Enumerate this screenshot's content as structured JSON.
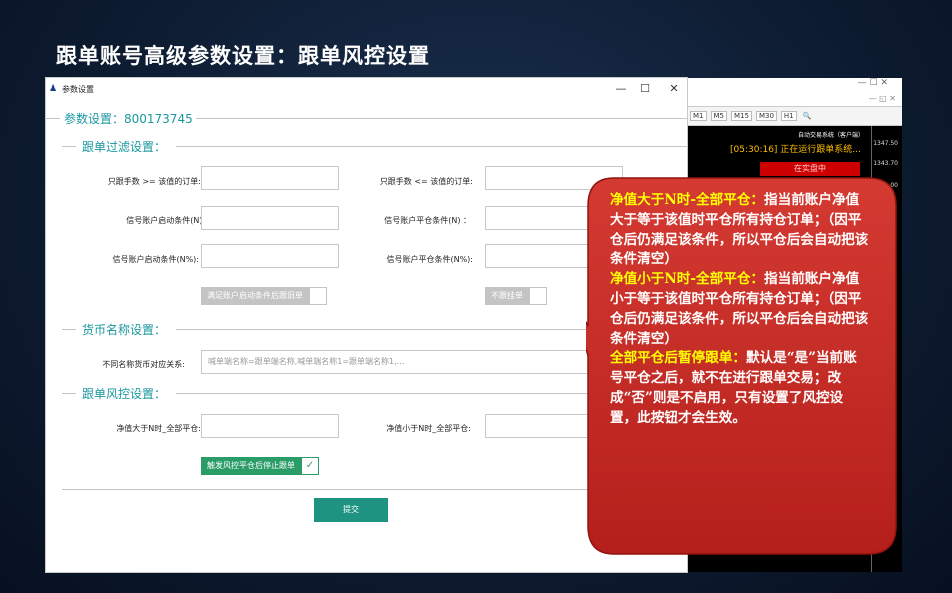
{
  "slide_title": "跟单账号高级参数设置：跟单风控设置",
  "dialog": {
    "title": "参数设置",
    "window_controls": [
      "—",
      "☐",
      "✕"
    ],
    "heading": "参数设置：800173745",
    "filter_section": {
      "title": "跟单过滤设置：",
      "fields": [
        {
          "label": "只跟手数 >= 该值的订单:"
        },
        {
          "label": "只跟手数 <= 该值的订单:"
        },
        {
          "label": "信号账户启动条件(N) ："
        },
        {
          "label": "信号账户平仓条件(N) ："
        },
        {
          "label": "信号账户启动条件(N%):"
        },
        {
          "label": "信号账户平仓条件(N%):"
        }
      ],
      "toggle_left": "满足账户启动条件后跟旧单",
      "toggle_right": "不跟挂单"
    },
    "currency_section": {
      "title": "货币名称设置：",
      "label": "不同名称货币对应关系:",
      "placeholder": "喊单端名称=跟单端名称,喊单端名称1=跟单端名称1,..."
    },
    "risk_section": {
      "title": "跟单风控设置：",
      "label_left": "净值大于N时_全部平仓:",
      "label_right": "净值小于N时_全部平仓:",
      "toggle": "触发风控平仓后停止跟单",
      "toggle_checked": true
    },
    "submit_label": "提交"
  },
  "background_window": {
    "window_controls": "— ☐ ✕",
    "sub_controls": "— ◱ ✕",
    "timeframes": [
      "M1",
      "M5",
      "M15",
      "M30",
      "H1"
    ],
    "ea_name": "自动交易系统（客户端）",
    "running_text": "[05:30:16] 正在运行跟单系统...",
    "status_text": "在实盘中",
    "prices": [
      "1347.50",
      "1343.70",
      "00"
    ]
  },
  "callout": {
    "para1_highlight": "净值大于N时-全部平仓：",
    "para1_text": "指当前账户净值大于等于该值时平仓所有持仓订单；（因平仓后仍满足该条件，所以平仓后会自动把该条件清空）",
    "para2_highlight": "净值小于N时-全部平仓：",
    "para2_text": "指当前账户净值小于等于该值时平仓所有持仓订单；（因平仓后仍满足该条件，所以平仓后会自动把该条件清空）",
    "para3_highlight": "全部平仓后暂停跟单：",
    "para3_text": "默认是“是”当前账号平仓之后，就不在进行跟单交易；改成“否”则是不启用，只有设置了风控设置，此按钮才会生效。"
  }
}
